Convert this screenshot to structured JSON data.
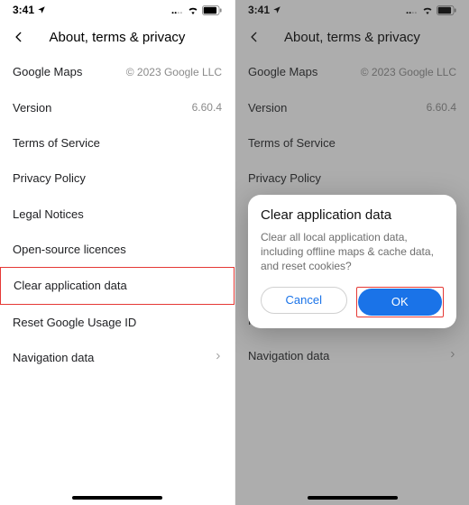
{
  "status": {
    "time": "3:41"
  },
  "nav": {
    "title": "About, terms & privacy"
  },
  "rows": {
    "maps_label": "Google Maps",
    "maps_value": "© 2023 Google LLC",
    "version_label": "Version",
    "version_value": "6.60.4",
    "tos": "Terms of Service",
    "privacy": "Privacy Policy",
    "legal": "Legal Notices",
    "oss": "Open-source licences",
    "clear": "Clear application data",
    "reset": "Reset Google Usage ID",
    "navdata": "Navigation data"
  },
  "dialog": {
    "title": "Clear application data",
    "body": "Clear all local application data, including offline maps & cache data, and reset cookies?",
    "cancel": "Cancel",
    "ok": "OK"
  }
}
